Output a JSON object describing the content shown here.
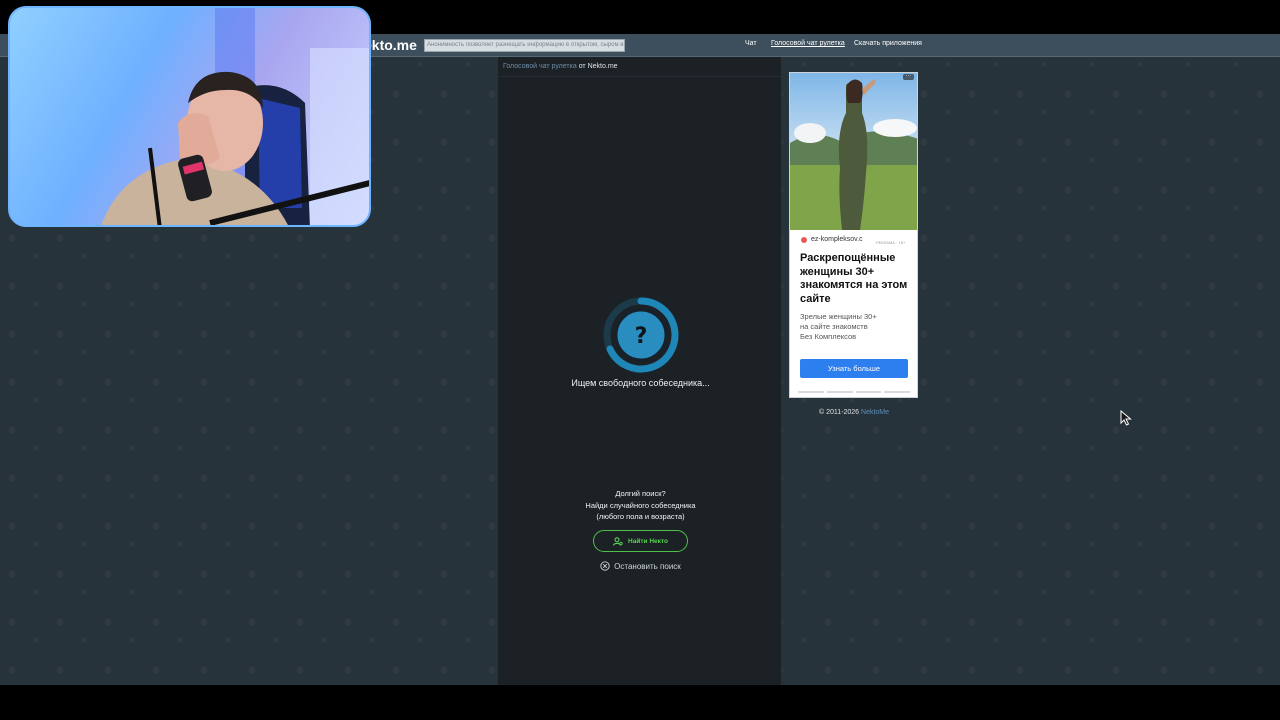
{
  "site": {
    "logo": "ekto.me",
    "tagline": "Анонимность позволяет разнещать информацию в открытом, сыром виде",
    "nav": {
      "chat": "Чат",
      "voice": "Голосовой чат рулетка",
      "apps": "Скачать приложения"
    }
  },
  "chat": {
    "breadcrumb_link": "Голосовой чат рулетка",
    "breadcrumb_rest": " от Nekto.me",
    "spinner_symbol": "?",
    "searching_text": "Ищем свободного собеседника...",
    "long_search": {
      "line1": "Долгий поиск?",
      "line2": "Найди случайного собеседника",
      "line3": "(любого пола и возраста)"
    },
    "find_button": "Найти Некто",
    "stop_button": "Остановить поиск"
  },
  "ad": {
    "menu": "···",
    "domain": "ez-kompleksov.c",
    "label": "РЕКЛАМА · 18+",
    "title": "Раскрепощённые женщины 30+ знакомятся на этом сайте",
    "body_line1": "Зрелые женщины 30+",
    "body_line2": "на сайте знакомств",
    "body_line3": "Без Комплексов",
    "button": "Узнать больше"
  },
  "footer": {
    "copyright": "© 2011-2026 ",
    "brand": "NektoMe"
  },
  "colors": {
    "accent_green": "#57d352",
    "spinner_blue": "#1f86b8",
    "ad_button": "#2d7ff0"
  }
}
